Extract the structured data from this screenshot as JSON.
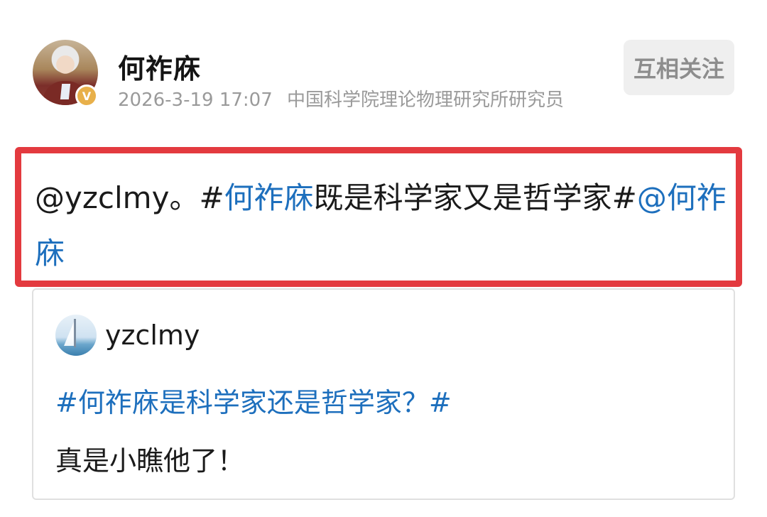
{
  "author": {
    "name": "何祚庥",
    "timestamp": "2026-3-19 17:07",
    "title": "中国科学院理论物理研究所研究员",
    "badge": "V",
    "badge_color": "#e8b04a"
  },
  "follow_button": {
    "label": "互相关注"
  },
  "post": {
    "mention_user": "@yzclmy",
    "punct": "。",
    "topic_open": "#",
    "topic_link": "何祚庥",
    "topic_rest": "既是科学家又是哲学家#",
    "mention_author": "@何祚庥",
    "highlight_color": "#e33a3f"
  },
  "quoted": {
    "username": "yzclmy",
    "topic": "#何祚庥是科学家还是哲学家？#",
    "body": "真是小瞧他了！"
  },
  "colors": {
    "link": "#1d6fbd",
    "text": "#1a1a1a",
    "meta": "#9a9a9a"
  }
}
